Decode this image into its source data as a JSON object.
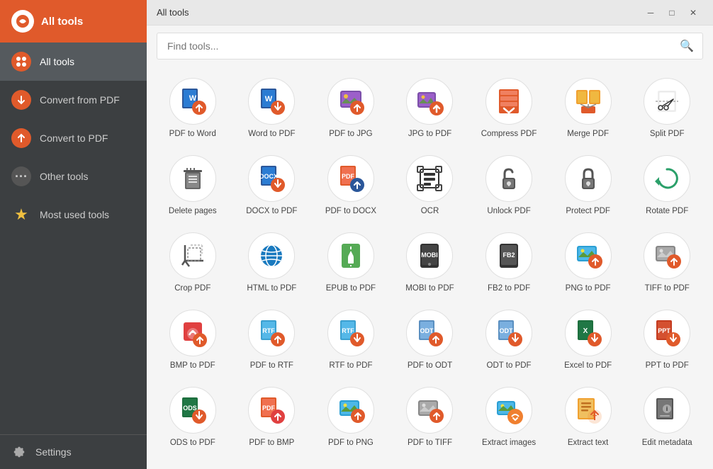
{
  "sidebar": {
    "title": "All tools",
    "items": [
      {
        "id": "all-tools",
        "label": "All tools",
        "active": true,
        "iconType": "logo"
      },
      {
        "id": "convert-from-pdf",
        "label": "Convert from PDF",
        "active": false,
        "iconType": "convert-from"
      },
      {
        "id": "convert-to-pdf",
        "label": "Convert to PDF",
        "active": false,
        "iconType": "convert-to"
      },
      {
        "id": "other-tools",
        "label": "Other tools",
        "active": false,
        "iconType": "other"
      },
      {
        "id": "most-used",
        "label": "Most used tools",
        "active": false,
        "iconType": "star"
      }
    ],
    "settings_label": "Settings"
  },
  "titlebar": {
    "title": "All tools"
  },
  "search": {
    "placeholder": "Find tools..."
  },
  "tools": [
    {
      "id": "pdf-to-word",
      "label": "PDF to Word"
    },
    {
      "id": "word-to-pdf",
      "label": "Word to PDF"
    },
    {
      "id": "pdf-to-jpg",
      "label": "PDF to JPG"
    },
    {
      "id": "jpg-to-pdf",
      "label": "JPG to PDF"
    },
    {
      "id": "compress-pdf",
      "label": "Compress PDF"
    },
    {
      "id": "merge-pdf",
      "label": "Merge PDF"
    },
    {
      "id": "split-pdf",
      "label": "Split PDF"
    },
    {
      "id": "delete-pages",
      "label": "Delete pages"
    },
    {
      "id": "docx-to-pdf",
      "label": "DOCX to PDF"
    },
    {
      "id": "pdf-to-docx",
      "label": "PDF to DOCX"
    },
    {
      "id": "ocr",
      "label": "OCR"
    },
    {
      "id": "unlock-pdf",
      "label": "Unlock PDF"
    },
    {
      "id": "protect-pdf",
      "label": "Protect PDF"
    },
    {
      "id": "rotate-pdf",
      "label": "Rotate PDF"
    },
    {
      "id": "crop-pdf",
      "label": "Crop PDF"
    },
    {
      "id": "html-to-pdf",
      "label": "HTML to PDF"
    },
    {
      "id": "epub-to-pdf",
      "label": "EPUB to PDF"
    },
    {
      "id": "mobi-to-pdf",
      "label": "MOBI to PDF"
    },
    {
      "id": "fb2-to-pdf",
      "label": "FB2 to PDF"
    },
    {
      "id": "png-to-pdf",
      "label": "PNG to PDF"
    },
    {
      "id": "tiff-to-pdf",
      "label": "TIFF to PDF"
    },
    {
      "id": "bmp-to-pdf",
      "label": "BMP to PDF"
    },
    {
      "id": "pdf-to-rtf",
      "label": "PDF to RTF"
    },
    {
      "id": "rtf-to-pdf",
      "label": "RTF to PDF"
    },
    {
      "id": "pdf-to-odt",
      "label": "PDF to ODT"
    },
    {
      "id": "odt-to-pdf",
      "label": "ODT to PDF"
    },
    {
      "id": "excel-to-pdf",
      "label": "Excel to PDF"
    },
    {
      "id": "ppt-to-pdf",
      "label": "PPT to PDF"
    },
    {
      "id": "ods-to-pdf",
      "label": "ODS to PDF"
    },
    {
      "id": "pdf-to-bmp",
      "label": "PDF to BMP"
    },
    {
      "id": "pdf-to-png",
      "label": "PDF to PNG"
    },
    {
      "id": "pdf-to-tiff",
      "label": "PDF to TIFF"
    },
    {
      "id": "extract-images",
      "label": "Extract images"
    },
    {
      "id": "extract-text",
      "label": "Extract text"
    },
    {
      "id": "edit-metadata",
      "label": "Edit metadata"
    }
  ]
}
